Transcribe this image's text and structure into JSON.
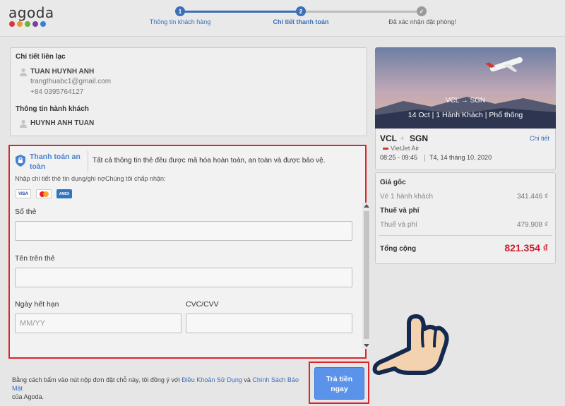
{
  "brand": {
    "name": "agoda",
    "dot_colors": [
      "#d8383a",
      "#e89a2e",
      "#6bb33c",
      "#7b3f9e",
      "#3a7fd0"
    ]
  },
  "steps": [
    {
      "number": "1",
      "label": "Thông tin khách hàng",
      "state": "done"
    },
    {
      "number": "2",
      "label": "Chi tiết thanh toán",
      "state": "active"
    },
    {
      "number": "✓",
      "label": "Đã xác nhận đặt phòng!",
      "state": "pending"
    }
  ],
  "contact": {
    "heading": "Chi tiết liên lạc",
    "name": "TUAN HUYNH ANH",
    "email": "trangthuabc1@gmail.com",
    "phone": "+84 0395764127"
  },
  "passenger": {
    "heading": "Thông tin hành khách",
    "name": "HUYNH ANH TUAN"
  },
  "payment": {
    "secure_label": "Thanh toán an toàn",
    "secure_note": "Tất cả thông tin thẻ đều được mã hóa hoàn toàn, an toàn và được bảo vệ.",
    "accepted_note": "Nhập chi tiết thẻ tín dụng/ghi nợChúng tôi chấp nhận:",
    "cards": [
      "VISA",
      "MC",
      "AMEX"
    ],
    "card_number_label": "Số thẻ",
    "card_number_value": "",
    "name_on_card_label": "Tên trên thẻ",
    "name_on_card_value": "",
    "expiry_label": "Ngày hết hạn",
    "expiry_placeholder": "MM/YY",
    "cvc_label": "CVC/CVV",
    "cvc_value": ""
  },
  "terms": {
    "prefix": "Bằng cách bấm vào nút nộp đơn đặt chỗ này, tôi đồng ý với ",
    "terms_link": "Điều Khoản Sử Dụng",
    "and": " và ",
    "privacy_link": "Chính Sách Bảo Mật",
    "suffix": "của Agoda."
  },
  "pay_button": {
    "line1": "Trả tiền",
    "line2": "ngay"
  },
  "flight": {
    "hero_route_from": "VCL",
    "hero_route_to": "SGN",
    "hero_summary": "14 Oct | 1 Hành Khách | Phổ thông",
    "from": "VCL",
    "to": "SGN",
    "details_link": "Chi tiết",
    "airline": "VietJet Air",
    "times": "08:25 - 09:45",
    "date": "T4, 14 tháng 10, 2020"
  },
  "pricing": {
    "base_heading": "Giá gốc",
    "per_passenger_label": "Vé 1 hành khách",
    "per_passenger_value": "341.446 ₫",
    "tax_heading": "Thuế và phí",
    "tax_label": "Thuế và phí",
    "tax_value": "479.908 ₫",
    "total_label": "Tổng cộng",
    "total_value": "821.354 ₫"
  },
  "colors": {
    "primary_blue": "#3a6fb8",
    "highlight_red": "#d9262b",
    "button_blue": "#5b93ea",
    "total_red": "#c81e2c"
  }
}
